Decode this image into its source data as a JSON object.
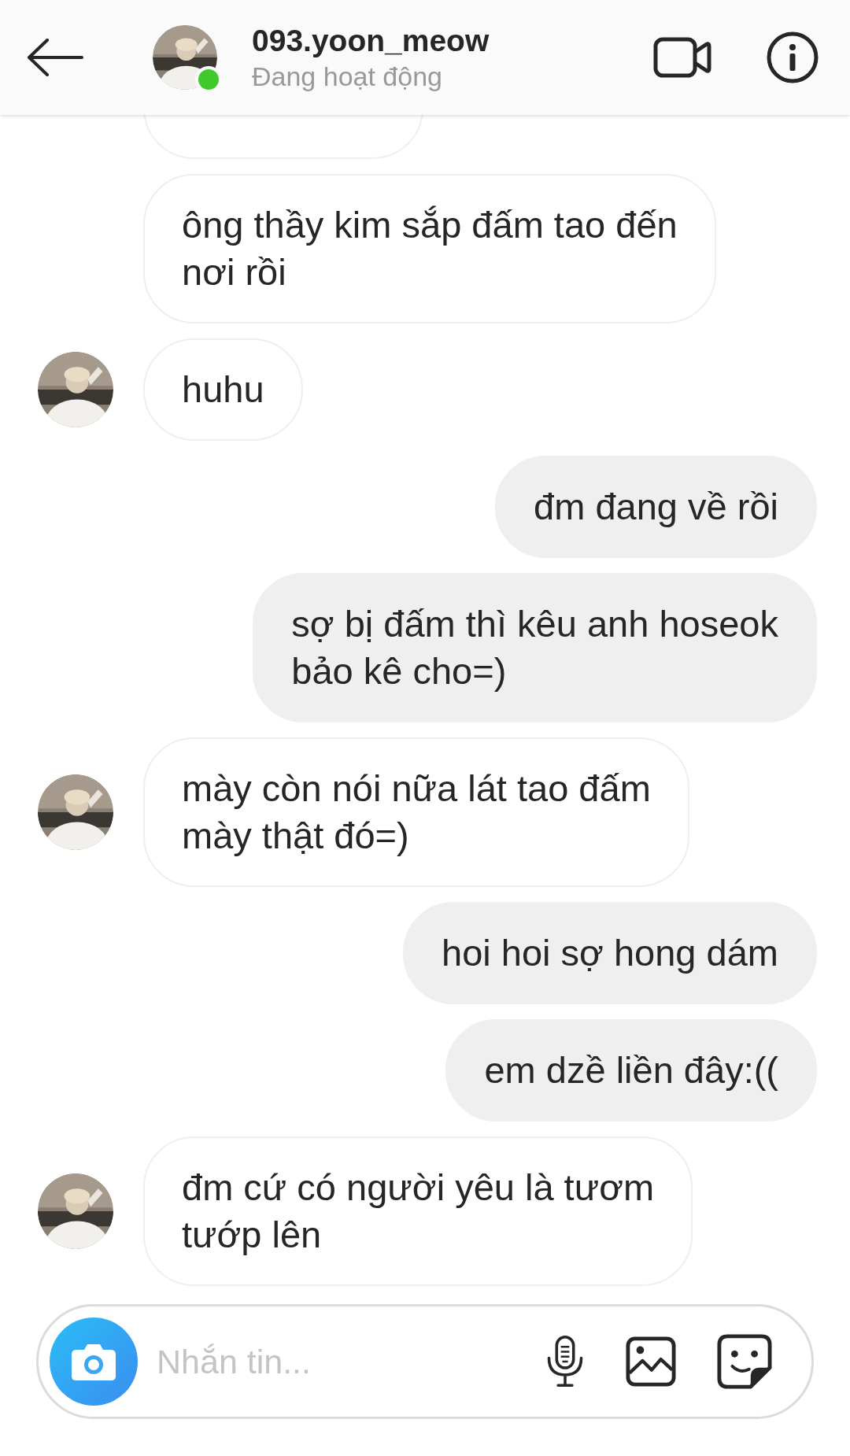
{
  "header": {
    "username": "093.yoon_meow",
    "status": "Đang hoạt động",
    "online": true
  },
  "messages": [
    {
      "outgoing": false,
      "kind": "clipped",
      "avatar": false
    },
    {
      "outgoing": false,
      "kind": "text",
      "text": "ông thầy kim sắp đấm tao đến\nnơi rồi",
      "avatar": false
    },
    {
      "outgoing": false,
      "kind": "text",
      "text": "huhu",
      "avatar": true
    },
    {
      "outgoing": true,
      "kind": "text",
      "text": "đm đang về rồi",
      "avatar": false
    },
    {
      "outgoing": true,
      "kind": "text",
      "text": "sợ bị đấm thì kêu anh hoseok\nbảo kê cho=)",
      "avatar": false
    },
    {
      "outgoing": false,
      "kind": "text",
      "text": "mày còn nói nữa lát tao đấm\nmày thật đó=)",
      "avatar": true
    },
    {
      "outgoing": true,
      "kind": "text",
      "text": "hoi hoi sợ hong dám",
      "avatar": false
    },
    {
      "outgoing": true,
      "kind": "text",
      "text": "em dzề liền đây:((",
      "avatar": false
    },
    {
      "outgoing": false,
      "kind": "text",
      "text": "đm cứ có người yêu là tươm\ntướp lên",
      "avatar": true
    }
  ],
  "composer": {
    "placeholder": "Nhắn tin..."
  }
}
